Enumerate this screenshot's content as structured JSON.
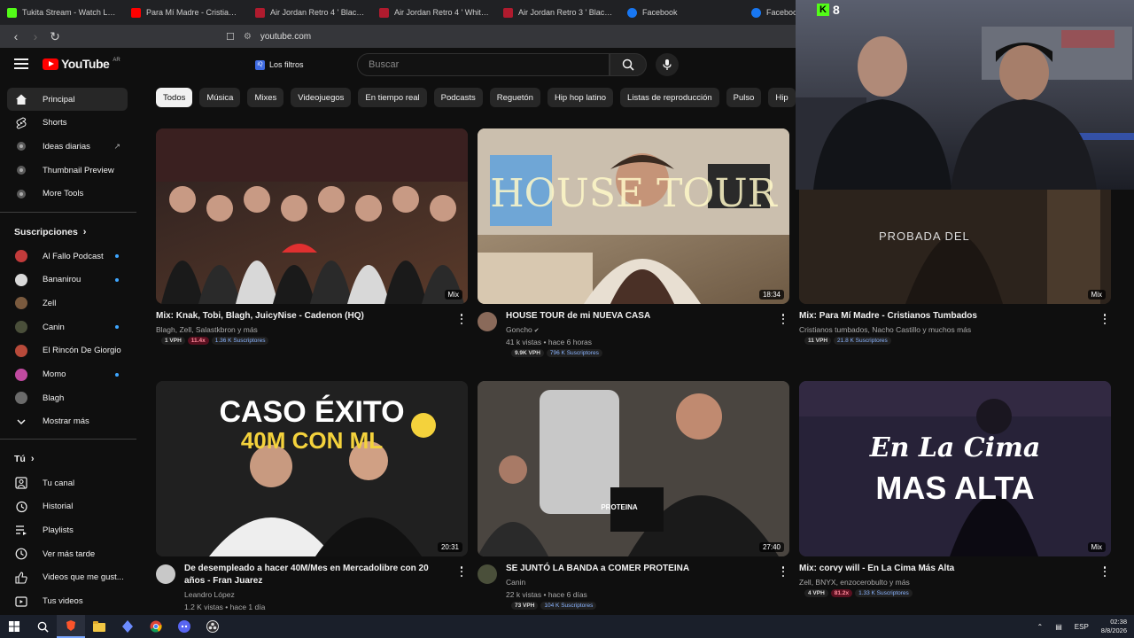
{
  "browser": {
    "tabs": [
      {
        "title": "Tukita Stream - Watch Live",
        "favicon": "kick"
      },
      {
        "title": "Para Mí Madre - Cristianos Tum",
        "favicon": "youtube"
      },
      {
        "title": "Air Jordan Retro 4 ' Black Cat",
        "favicon": "jordan"
      },
      {
        "title": "Air Jordan Retro 4 ' White Thu",
        "favicon": "jordan"
      },
      {
        "title": "Air Jordan Retro 3 ' Black Cat",
        "favicon": "jordan"
      },
      {
        "title": "Facebook",
        "favicon": "facebook"
      },
      {
        "title": "Facebook",
        "favicon": "facebook"
      }
    ],
    "url": "youtube.com"
  },
  "youtube": {
    "logo_text": "YouTube",
    "country_code": "AR",
    "filters_label": "Los filtros",
    "search_placeholder": "Buscar"
  },
  "sidebar": {
    "main": [
      {
        "label": "Principal",
        "icon": "home-icon",
        "active": true
      },
      {
        "label": "Shorts",
        "icon": "shorts-icon"
      },
      {
        "label": "Ideas diarias",
        "icon": "extension-icon",
        "external": true
      },
      {
        "label": "Thumbnail Preview",
        "icon": "extension-icon"
      },
      {
        "label": "More Tools",
        "icon": "extension-icon"
      }
    ],
    "subscriptions_title": "Suscripciones",
    "subscriptions": [
      {
        "label": "Al Fallo Podcast",
        "color": "#c23b3b",
        "dot": true
      },
      {
        "label": "Bananirou",
        "color": "#d9d9d9",
        "dot": true
      },
      {
        "label": "Zell",
        "color": "#7a5a3e",
        "dot": false
      },
      {
        "label": "Canin",
        "color": "#4a4f3a",
        "dot": true
      },
      {
        "label": "El Rincón De Giorgio",
        "color": "#b84a3a",
        "dot": false
      },
      {
        "label": "Momo",
        "color": "#c04aa0",
        "dot": true
      },
      {
        "label": "Blagh",
        "color": "#6b6b6b",
        "dot": false
      }
    ],
    "show_more": "Mostrar más",
    "you_title": "Tú",
    "you_items": [
      {
        "label": "Tu canal",
        "icon": "channel-icon"
      },
      {
        "label": "Historial",
        "icon": "history-icon"
      },
      {
        "label": "Playlists",
        "icon": "playlists-icon"
      },
      {
        "label": "Ver más tarde",
        "icon": "watch-later-icon"
      },
      {
        "label": "Videos que me gust...",
        "icon": "like-icon"
      },
      {
        "label": "Tus videos",
        "icon": "your-videos-icon"
      }
    ]
  },
  "chips": [
    "Todos",
    "Música",
    "Mixes",
    "Videojuegos",
    "En tiempo real",
    "Podcasts",
    "Reguetón",
    "Hip hop latino",
    "Listas de reproducción",
    "Pulso",
    "Hip"
  ],
  "videos": [
    {
      "title": "Mix: Knak, Tobi, Blagh, JuicyNise - Cadenon (HQ)",
      "channel": "Blagh, Zell, Salastkbron y más",
      "views": "",
      "badge": "Mix",
      "stats": [
        "1 VPH",
        "11.4x",
        "1.36 K Suscriptores"
      ],
      "thumb_colors": [
        "#2a1f1f",
        "#5a3a2a"
      ],
      "avatar": false
    },
    {
      "title": "HOUSE TOUR de mi NUEVA CASA",
      "channel": "Goncho",
      "views": "41 k vistas • hace 6 horas",
      "badge": "18:34",
      "verified": true,
      "stats": [
        "9.9K VPH",
        "796 K Suscriptores"
      ],
      "thumb_text": "HOUSE TOUR",
      "thumb_colors": [
        "#b9a58a",
        "#6e5a44"
      ],
      "avatar": true,
      "avatar_color": "#8a6a5a"
    },
    {
      "title": "Mix: Para Mí Madre - Cristianos Tumbados",
      "channel": "Cristianos tumbados, Nacho Castillo y muchos más",
      "views": "",
      "badge": "Mix",
      "stats": [
        "11 VPH",
        "21.8 K Suscriptores"
      ],
      "thumb_text": "PROBADA DEL",
      "thumb_colors": [
        "#4a3a30",
        "#2a201a"
      ],
      "avatar": false
    },
    {
      "title": "De desempleado a hacer 40M/Mes en Mercadolibre con 20 años - Fran Juarez",
      "channel": "Leandro López",
      "views": "1.2 K vistas • hace 1 día",
      "badge": "20:31",
      "stats": [],
      "thumb_text": "CASO ÉXITO",
      "thumb_text2": "40M CON ML",
      "thumb_colors": [
        "#2a2a2a",
        "#1a1a1a"
      ],
      "avatar": true,
      "avatar_color": "#c8c8c8"
    },
    {
      "title": "SE JUNTÓ LA BANDA a COMER PROTEINA",
      "channel": "Canin",
      "views": "22 k vistas • hace 6 días",
      "badge": "27:40",
      "stats": [
        "73 VPH",
        "104 K Suscriptores"
      ],
      "thumb_text": "PROTEINA",
      "thumb_colors": [
        "#5a5550",
        "#2a2826"
      ],
      "avatar": true,
      "avatar_color": "#4a4f3a"
    },
    {
      "title": "Mix: corvy will - En La Cima Más Alta",
      "channel": "Zell, BNYX, enzocerobulto y más",
      "views": "",
      "badge": "Mix",
      "stats": [
        "4 VPH",
        "81.2x",
        "1.33 K Suscriptores"
      ],
      "thumb_text": "En La Cima",
      "thumb_text2": "MAS ALTA",
      "thumb_colors": [
        "#3a3550",
        "#14121e"
      ],
      "avatar": false
    }
  ],
  "webcam": {
    "kick_count": "8"
  },
  "taskbar": {
    "language": "ESP",
    "time": "02:38",
    "date": "8/8/2026"
  }
}
